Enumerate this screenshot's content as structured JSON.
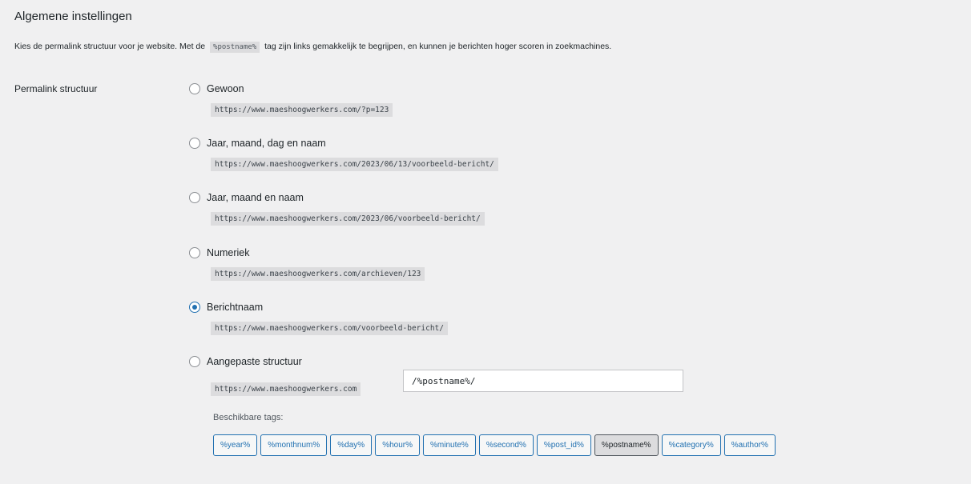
{
  "section_title": "Algemene instellingen",
  "intro": {
    "before": "Kies de permalink structuur voor je website. Met de",
    "code": "%postname%",
    "after": "tag zijn links gemakkelijk te begrijpen, en kunnen je berichten hoger scoren in zoekmachines."
  },
  "row_label": "Permalink structuur",
  "options": [
    {
      "label": "Gewoon",
      "url": "https://www.maeshoogwerkers.com/?p=123",
      "checked": false
    },
    {
      "label": "Jaar, maand, dag en naam",
      "url": "https://www.maeshoogwerkers.com/2023/06/13/voorbeeld-bericht/",
      "checked": false
    },
    {
      "label": "Jaar, maand en naam",
      "url": "https://www.maeshoogwerkers.com/2023/06/voorbeeld-bericht/",
      "checked": false
    },
    {
      "label": "Numeriek",
      "url": "https://www.maeshoogwerkers.com/archieven/123",
      "checked": false
    },
    {
      "label": "Berichtnaam",
      "url": "https://www.maeshoogwerkers.com/voorbeeld-bericht/",
      "checked": true
    },
    {
      "label": "Aangepaste structuur",
      "url": "https://www.maeshoogwerkers.com",
      "checked": false
    }
  ],
  "custom_structure_value": "/%postname%/",
  "available_tags_label": "Beschikbare tags:",
  "tags": [
    "%year%",
    "%monthnum%",
    "%day%",
    "%hour%",
    "%minute%",
    "%second%",
    "%post_id%",
    "%postname%",
    "%category%",
    "%author%"
  ],
  "active_tag": "%postname%",
  "colors": {
    "accent": "#2271b1",
    "background": "#f0f0f1",
    "code_background": "#dcdcde"
  }
}
